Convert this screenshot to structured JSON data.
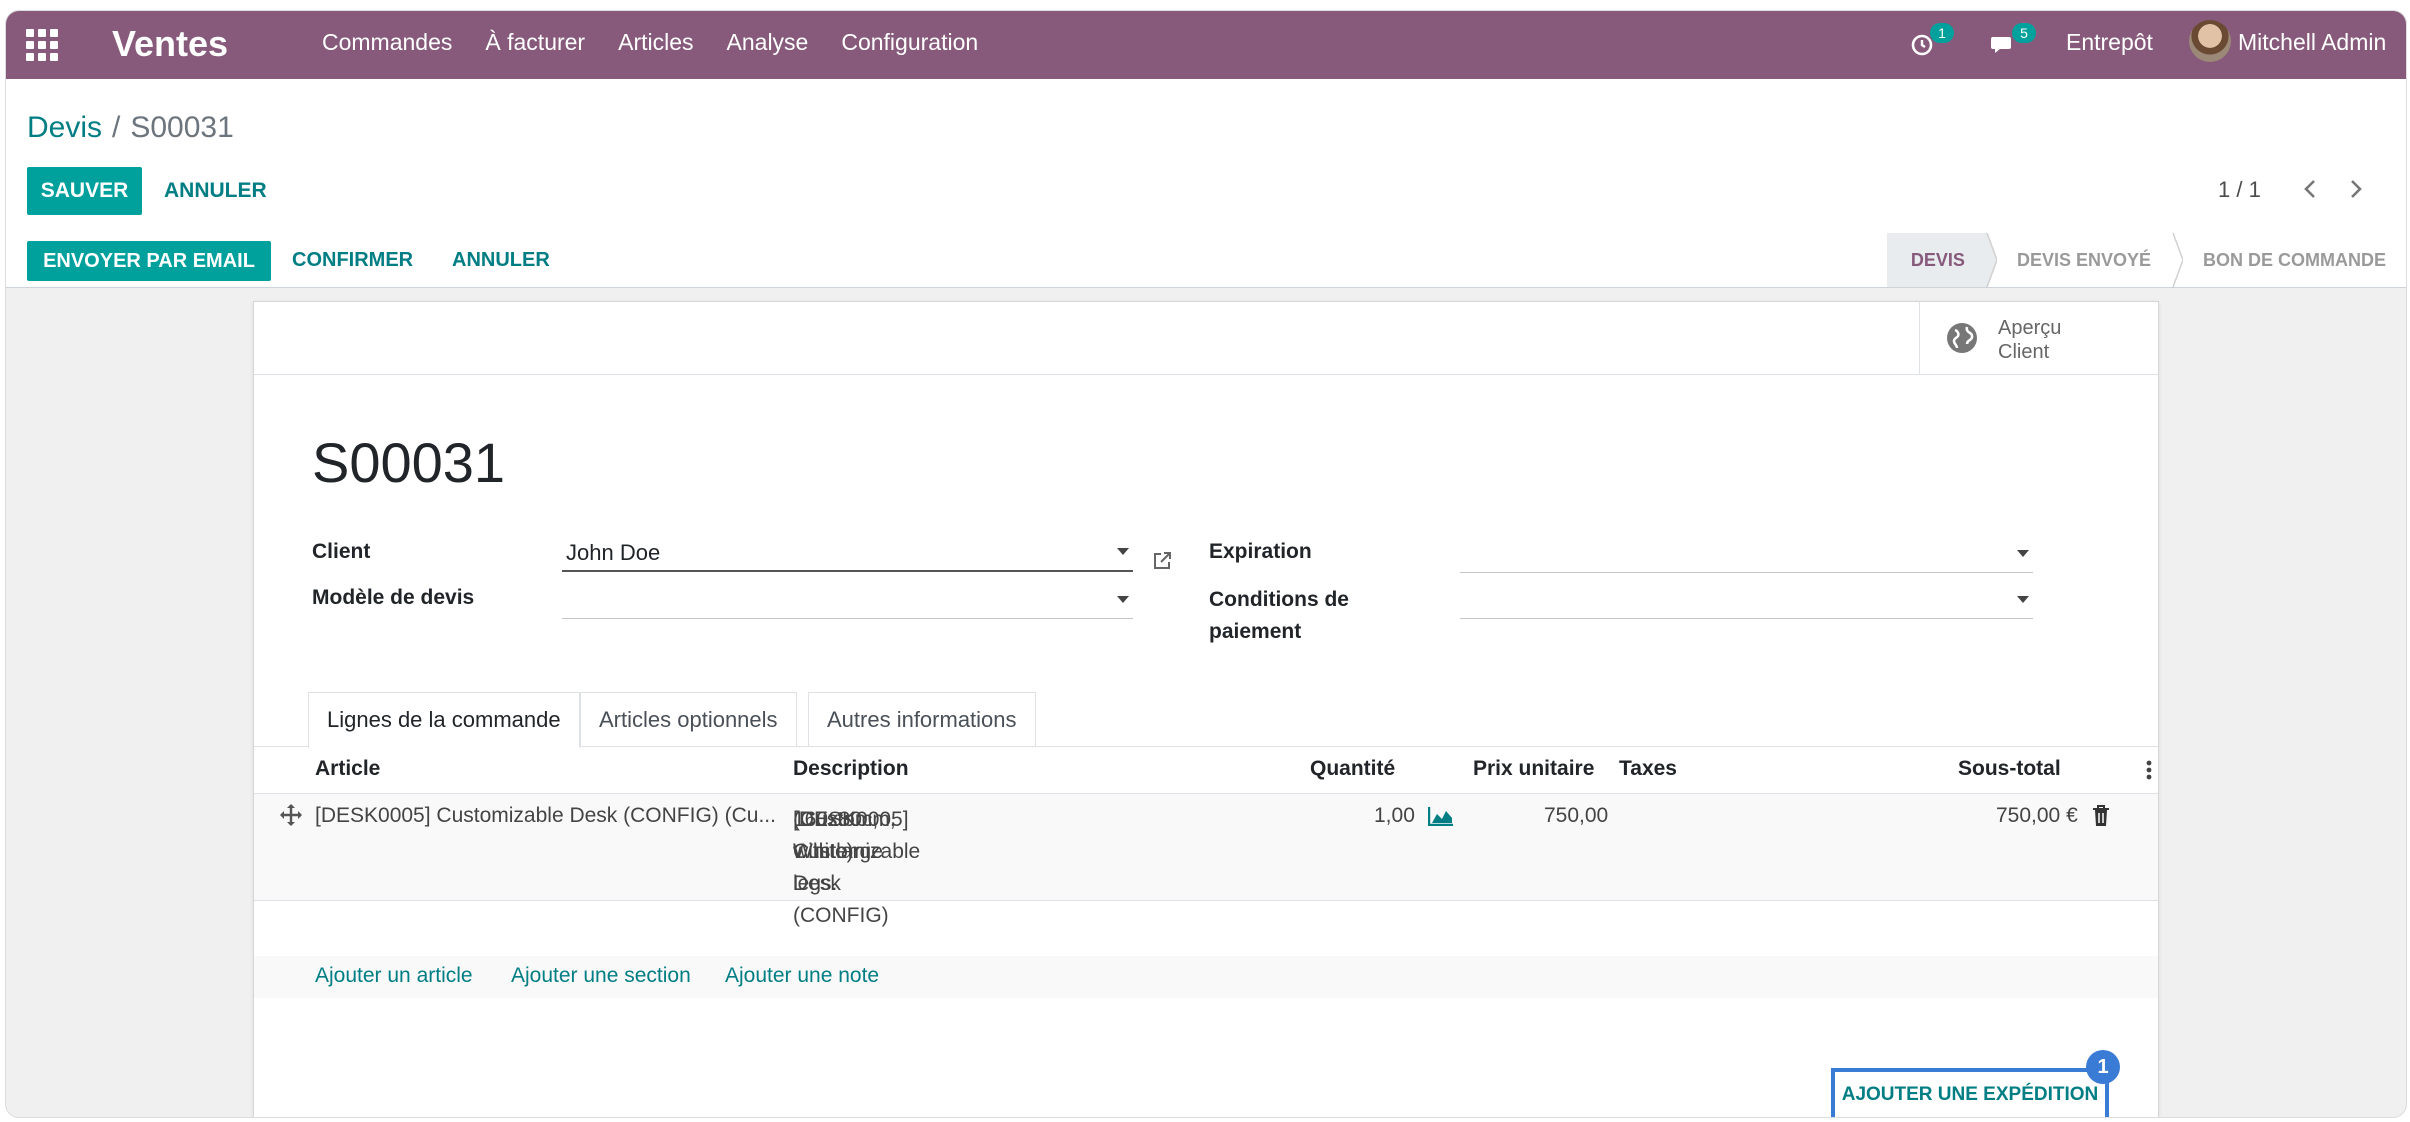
{
  "navbar": {
    "brand": "Ventes",
    "menu": [
      "Commandes",
      "À facturer",
      "Articles",
      "Analyse",
      "Configuration"
    ],
    "activity_count": "1",
    "messages_count": "5",
    "warehouse": "Entrepôt",
    "user": "Mitchell Admin"
  },
  "breadcrumb": {
    "parent": "Devis",
    "separator": "/",
    "current": "S00031"
  },
  "control": {
    "save": "Sauver",
    "discard": "Annuler",
    "pager": "1 / 1"
  },
  "statusbar": {
    "actions": [
      "Envoyer par email",
      "Confirmer",
      "Annuler"
    ],
    "stages": [
      "Devis",
      "Devis envoyé",
      "Bon de commande"
    ],
    "active_stage": "Devis"
  },
  "sheet": {
    "preview": {
      "line1": "Aperçu",
      "line2": "Client"
    },
    "name": "S00031",
    "fields": {
      "client_label": "Client",
      "client_value": "John Doe",
      "template_label": "Modèle de devis",
      "template_value": "",
      "expiration_label": "Expiration",
      "expiration_value": "",
      "payment_label_1": "Conditions de",
      "payment_label_2": "paiement",
      "payment_value": ""
    },
    "tabs": [
      "Lignes de la commande",
      "Articles optionnels",
      "Autres informations"
    ],
    "table": {
      "headers": [
        "Article",
        "Description",
        "Quantité",
        "Prix unitaire",
        "Taxes",
        "Sous-total"
      ],
      "rows": [
        {
          "article": "[DESK0005] Customizable Desk (CONFIG) (Cu...",
          "description_1": "[DESK0005] Customizable Desk (CONFIG)",
          "description_2": "(Custom, White)",
          "description_3": "160x80cm, with large legs.",
          "quantity": "1,00",
          "price": "750,00",
          "taxes": "",
          "subtotal": "750,00 €"
        }
      ]
    },
    "add_links": [
      "Ajouter un article",
      "Ajouter une section",
      "Ajouter une note"
    ],
    "shipping_button": "Ajouter une expédition",
    "step_number": "1"
  },
  "colors": {
    "brand": "#875a7b",
    "primary": "#00a09d",
    "link": "#017e84",
    "highlight": "#3a7bd5"
  },
  "icons": [
    "apps-icon",
    "activity-clock-icon",
    "chat-icon",
    "external-link-icon",
    "globe-icon",
    "drag-handle-icon",
    "forecast-chart-icon",
    "trash-icon",
    "kebab-menu-icon",
    "chevron-left-icon",
    "chevron-right-icon"
  ]
}
